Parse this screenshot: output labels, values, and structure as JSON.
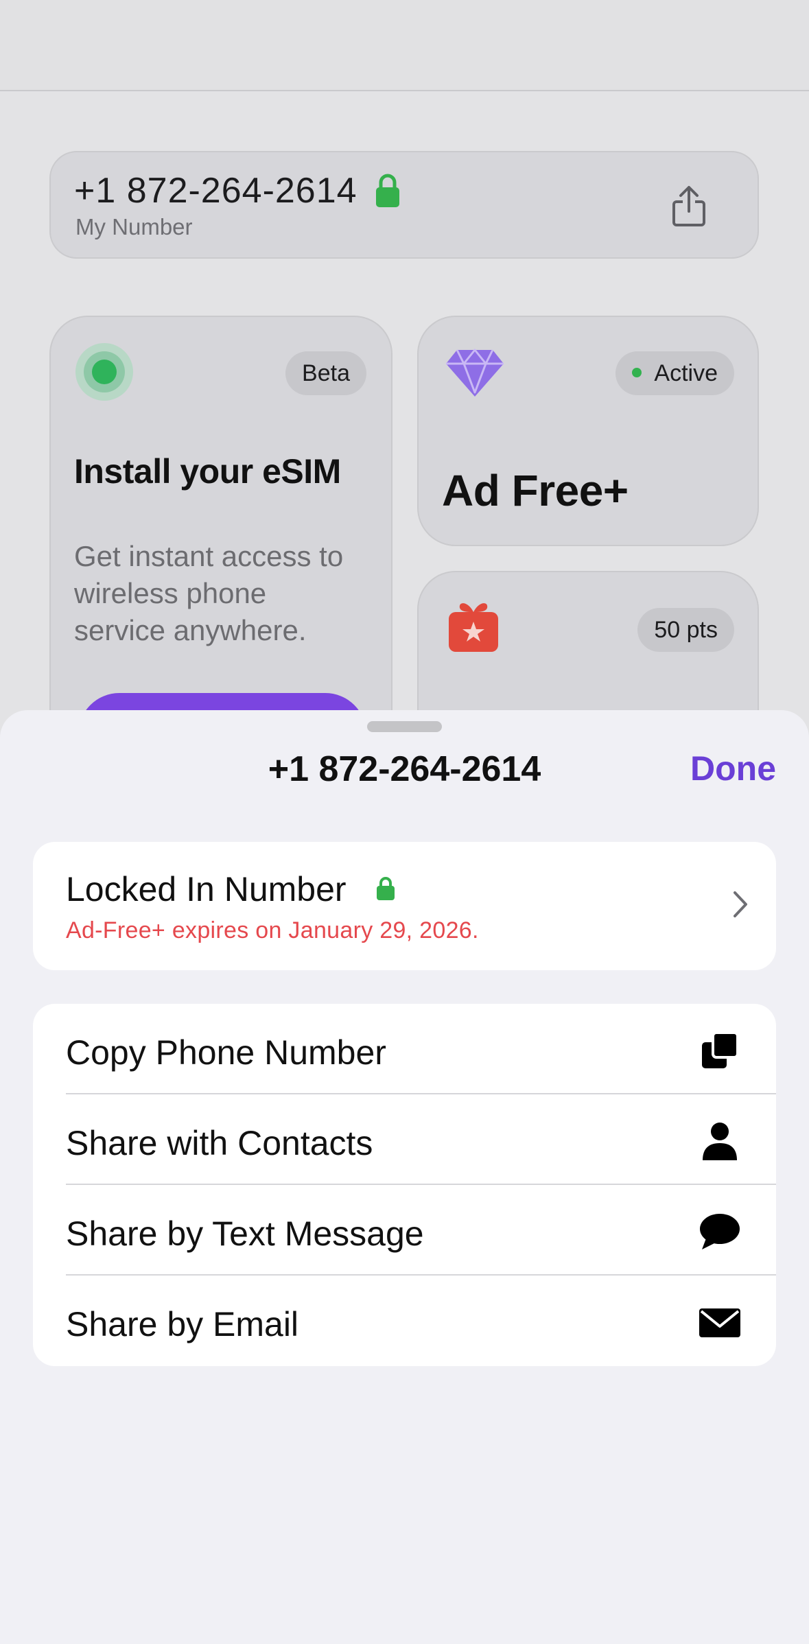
{
  "background": {
    "number_card": {
      "phone_number": "+1 872-264-2614",
      "label": "My Number"
    },
    "esim_card": {
      "badge": "Beta",
      "title": "Install your eSIM",
      "description": "Get instant access to wireless phone service anywhere."
    },
    "adfree_card": {
      "badge": "Active",
      "title": "Ad Free+"
    },
    "points_card": {
      "badge": "50 pts"
    }
  },
  "sheet": {
    "title": "+1 872-264-2614",
    "done_label": "Done",
    "locked": {
      "title": "Locked In Number",
      "subtitle": "Ad-Free+ expires on January 29, 2026."
    },
    "share_options": [
      {
        "label": "Copy Phone Number",
        "icon": "copy-icon"
      },
      {
        "label": "Share with Contacts",
        "icon": "person-icon"
      },
      {
        "label": "Share by Text Message",
        "icon": "message-bubble-icon"
      },
      {
        "label": "Share by Email",
        "icon": "envelope-icon"
      }
    ]
  },
  "colors": {
    "accent": "#6a3fd6",
    "lock_green": "#35b04c",
    "warning_red": "#e5484d",
    "gift_red": "#e2493b",
    "diamond_purple": "#8e6ee6"
  }
}
